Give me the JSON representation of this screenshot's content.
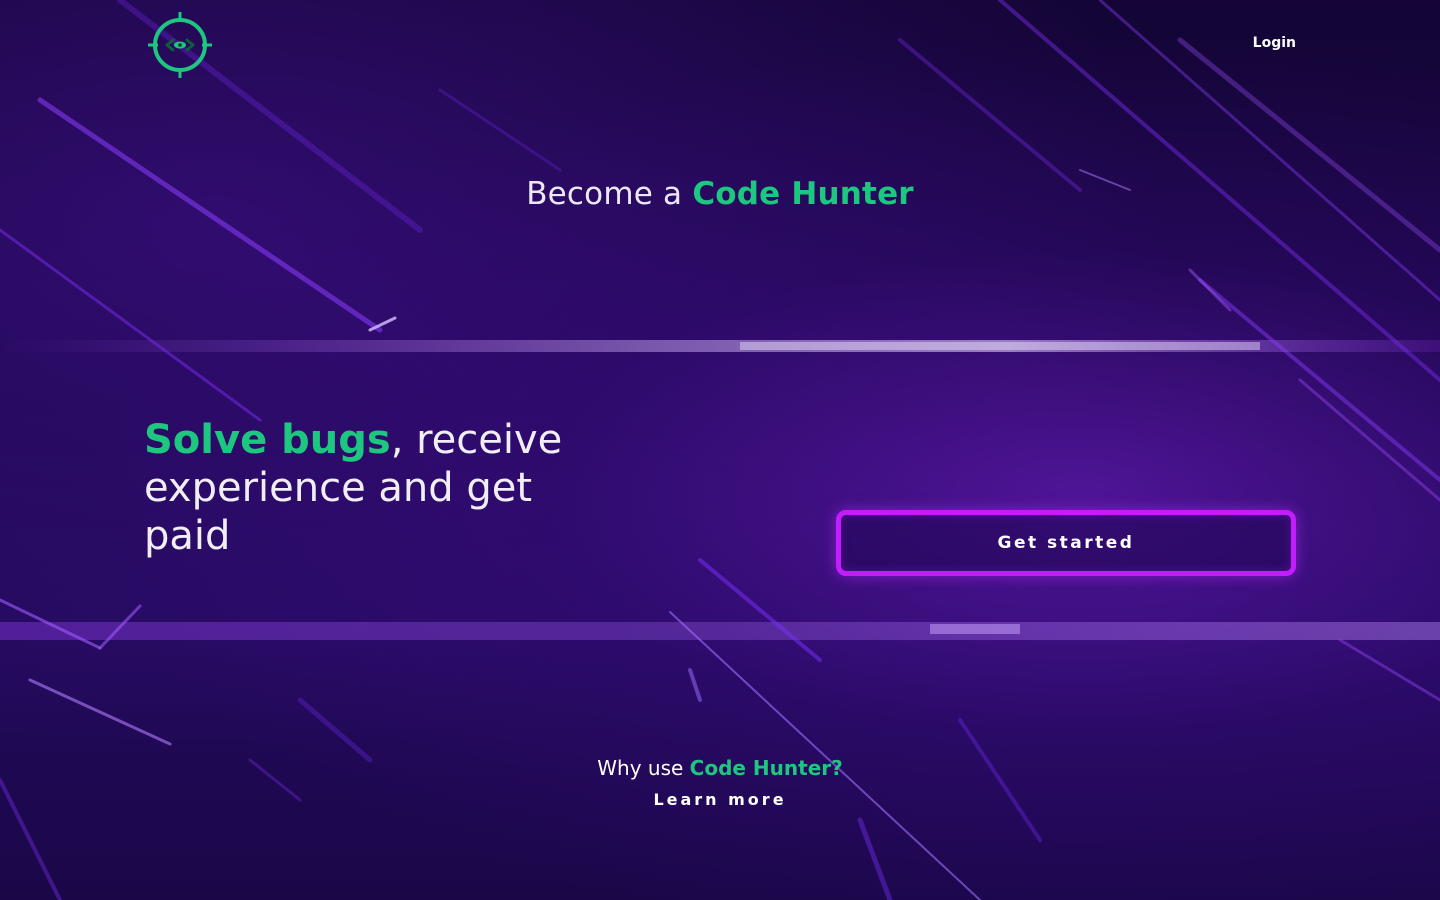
{
  "header": {
    "logo_icon": "crosshair-eye-icon",
    "login_label": "Login"
  },
  "hero": {
    "title_prefix": "Become a ",
    "title_accent": "Code Hunter"
  },
  "tagline": {
    "accent": "Solve bugs",
    "rest": ", receive experience and get paid"
  },
  "cta": {
    "label": "Get started"
  },
  "why": {
    "prefix": "Why use ",
    "accent": "Code Hunter?",
    "learn_more_label": "Learn more"
  },
  "colors": {
    "accent_green": "#1ec77f",
    "button_border": "#c21cff",
    "background": "#16063f"
  }
}
